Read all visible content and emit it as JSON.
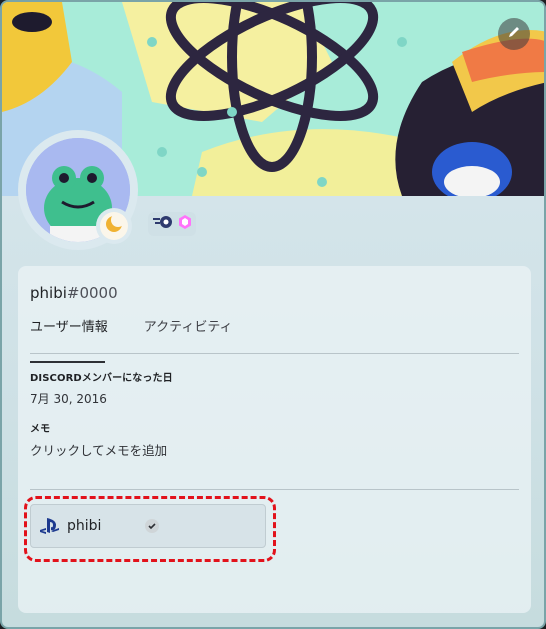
{
  "profile": {
    "username": "phibi",
    "discriminator": "#0000"
  },
  "tabs": [
    {
      "label": "ユーザー情報"
    },
    {
      "label": "アクティビティ"
    }
  ],
  "member_since": {
    "title": "DISCORDメンバーになった日",
    "value": "7月 30, 2016"
  },
  "memo": {
    "title": "メモ",
    "placeholder": "クリックしてメモを追加"
  },
  "connections": [
    {
      "service": "playstation-icon",
      "name": "phibi",
      "verified": true
    }
  ],
  "colors": {
    "highlight": "#e2121b",
    "status_idle": "#f0b232",
    "nitro_pink": "#ff73fa"
  }
}
